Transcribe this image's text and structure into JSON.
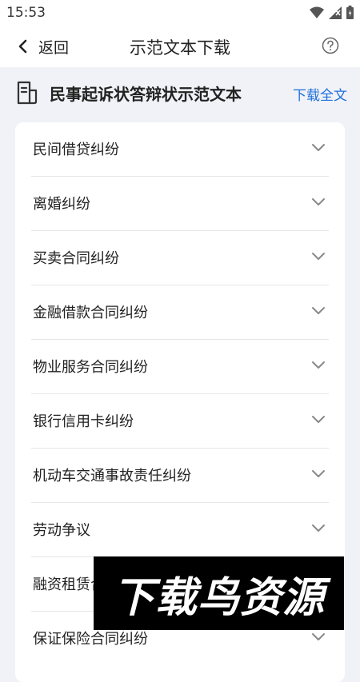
{
  "status_bar": {
    "time": "15:53",
    "icons": [
      "wifi-icon",
      "signal-icon",
      "battery-icon"
    ]
  },
  "nav": {
    "back_label": "返回",
    "title": "示范文本下载",
    "help_icon": "help-circle-icon"
  },
  "section": {
    "title": "民事起诉状答辩状示范文本",
    "download_label": "下载全文",
    "icon": "document-icon"
  },
  "categories": [
    "民间借贷纠纷",
    "离婚纠纷",
    "买卖合同纠纷",
    "金融借款合同纠纷",
    "物业服务合同纠纷",
    "银行信用卡纠纷",
    "机动车交通事故责任纠纷",
    "劳动争议",
    "融资租赁合同纠纷",
    "保证保险合同纠纷"
  ],
  "watermark": {
    "text": "下载鸟资源"
  },
  "colors": {
    "accent": "#1e6fd9",
    "background": "#f0f2f7",
    "card": "#ffffff",
    "divider": "#e4e6ea",
    "text": "#222222",
    "chevron": "#888888"
  }
}
